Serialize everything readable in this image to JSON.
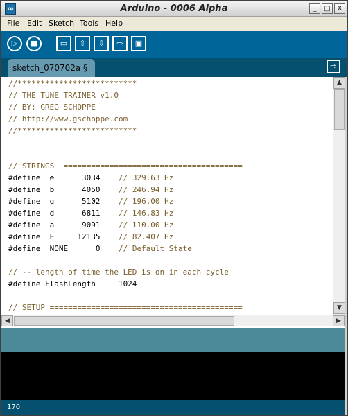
{
  "window": {
    "title": "Arduino - 0006 Alpha",
    "icon": "arduino-logo-icon"
  },
  "window_controls": {
    "minimize": "_",
    "maximize": "□",
    "close": "X"
  },
  "menu": [
    "File",
    "Edit",
    "Sketch",
    "Tools",
    "Help"
  ],
  "toolbar": {
    "run_icon": "▷",
    "stop_icon": "■",
    "new_icon": "▭",
    "open_icon": "⇧",
    "save_icon": "⇩",
    "export_icon": "⇨",
    "serial_monitor_icon": "▣"
  },
  "tab": {
    "label": "sketch_070702a §",
    "serial_button": "⇨"
  },
  "editor": {
    "lines": [
      {
        "text": "//**************************",
        "type": "comment"
      },
      {
        "text": "// THE TUNE TRAINER v1.0",
        "type": "comment"
      },
      {
        "text": "// BY: GREG SCHOPPE",
        "type": "comment"
      },
      {
        "text": "// http://www.gschoppe.com",
        "type": "comment"
      },
      {
        "text": "//**************************",
        "type": "comment"
      },
      {
        "text": "",
        "type": "plain"
      },
      {
        "text": "",
        "type": "plain"
      },
      {
        "text": "// STRINGS  =======================================",
        "type": "comment"
      },
      {
        "text": "#define  e      3034",
        "comment": "// 329.63 Hz",
        "type": "mixed"
      },
      {
        "text": "#define  b      4050",
        "comment": "// 246.94 Hz",
        "type": "mixed"
      },
      {
        "text": "#define  g      5102",
        "comment": "// 196.00 Hz",
        "type": "mixed"
      },
      {
        "text": "#define  d      6811",
        "comment": "// 146.83 Hz",
        "type": "mixed"
      },
      {
        "text": "#define  a      9091",
        "comment": "// 110.00 Hz",
        "type": "mixed"
      },
      {
        "text": "#define  E     12135",
        "comment": "// 82.407 Hz",
        "type": "mixed"
      },
      {
        "text": "#define  NONE      0",
        "comment": "// Default State",
        "type": "mixed"
      },
      {
        "text": "",
        "type": "plain"
      },
      {
        "text": "// -- length of time the LED is on in each cycle",
        "type": "comment"
      },
      {
        "text": "#define FlashLength     1024",
        "type": "plain"
      },
      {
        "text": "",
        "type": "plain"
      },
      {
        "text": "// SETUP ==========================================",
        "type": "comment"
      }
    ]
  },
  "scrollbars": {
    "up": "▲",
    "down": "▼",
    "left": "◀",
    "right": "▶"
  },
  "status": {
    "line_number": "170"
  }
}
